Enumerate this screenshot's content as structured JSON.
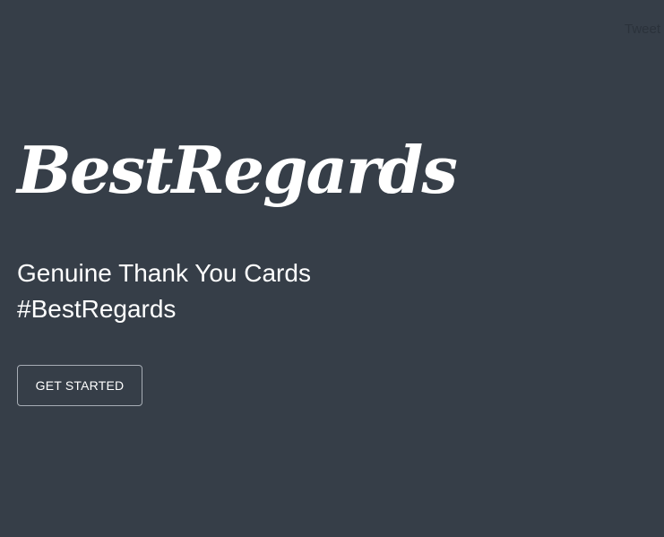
{
  "header": {
    "tweet_label": "Tweet"
  },
  "hero": {
    "title": "BestRegards",
    "tagline_line1": "Genuine Thank You Cards",
    "tagline_line2": "#BestRegards",
    "cta_label": "GET STARTED"
  },
  "colors": {
    "background": "#363e48",
    "text": "#ffffff",
    "button_border": "#a7adb5"
  }
}
